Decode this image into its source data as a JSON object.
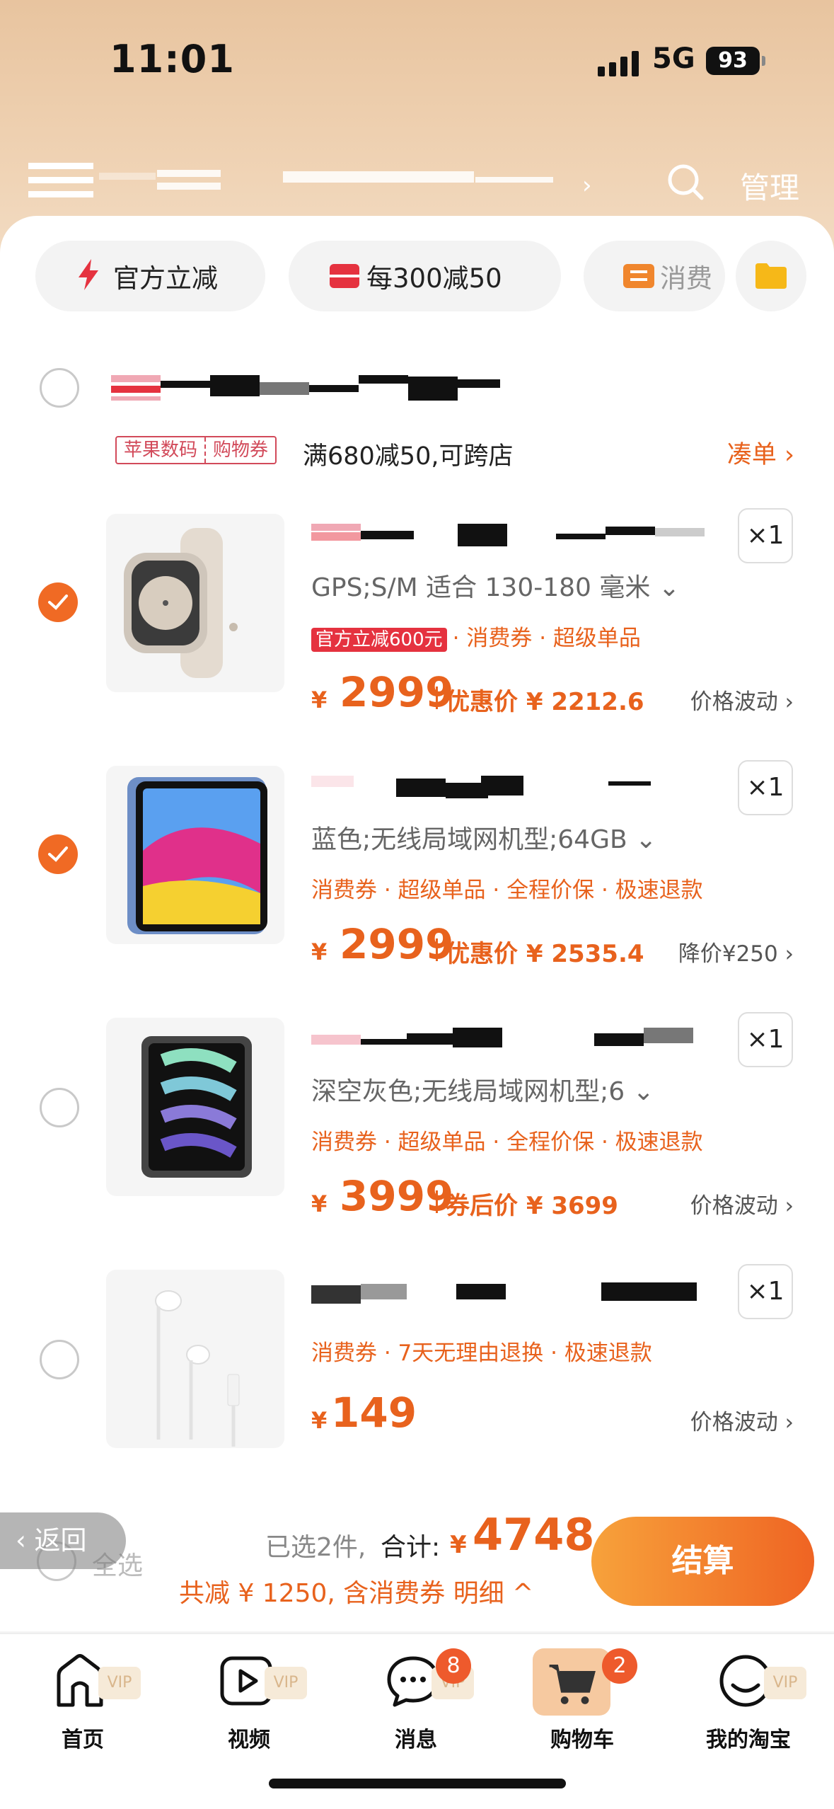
{
  "status_bar": {
    "time": "11:01",
    "network": "5G",
    "battery": "93"
  },
  "header": {
    "chevron": "›",
    "manage": "管理"
  },
  "chips": [
    {
      "label": "官方立减",
      "icon": "lightning-icon"
    },
    {
      "label": "每300减50",
      "icon": "coupon-icon"
    },
    {
      "label": "消费",
      "icon": "ticket-icon"
    }
  ],
  "store": {
    "coupon_tag_left": "苹果数码",
    "coupon_tag_right": "购物券",
    "coupon_text": "满680减50,可跨店",
    "coudan": "凑单 ›"
  },
  "items": [
    {
      "checked": true,
      "qty": "×1",
      "spec": "GPS;S/M 适合 130-180 毫米 ⌄",
      "red_tag": "官方立减600元",
      "tags": "· 消费券 · 超级单品",
      "yen": "¥",
      "price": "2999",
      "deal": "优惠价 ¥ 2212.6",
      "trend": "价格波动 ›"
    },
    {
      "checked": true,
      "qty": "×1",
      "spec": "蓝色;无线局域网机型;64GB ⌄",
      "red_tag": "",
      "tags": "消费券 · 超级单品 · 全程价保 · 极速退款",
      "yen": "¥",
      "price": "2999",
      "deal": "优惠价 ¥ 2535.4",
      "trend": "降价¥250 ›"
    },
    {
      "checked": false,
      "qty": "×1",
      "spec": "深空灰色;无线局域网机型;6  ⌄",
      "red_tag": "",
      "tags": "消费券 · 超级单品 · 全程价保 · 极速退款",
      "yen": "¥",
      "price": "3999",
      "deal": "券后价 ¥ 3699",
      "trend": "价格波动 ›"
    },
    {
      "checked": false,
      "qty": "×1",
      "spec": "",
      "red_tag": "",
      "tags": "消费券 · 7天无理由退换 · 极速退款",
      "yen": "¥",
      "price": "149",
      "deal": "",
      "trend": "价格波动 ›"
    }
  ],
  "checkout": {
    "back": "‹ 返回",
    "select_all": "全选",
    "selected_count": "已选2件,",
    "total_label": "合计:",
    "total_yen": "¥",
    "total": "4748",
    "saved": "共减 ¥ 1250, 含消费券  明细 ^",
    "pay_button": "结算"
  },
  "tabbar": [
    {
      "label": "首页",
      "icon": "home-icon",
      "vip": "VIP",
      "badge": ""
    },
    {
      "label": "视频",
      "icon": "video-play-icon",
      "vip": "VIP",
      "badge": ""
    },
    {
      "label": "消息",
      "icon": "message-icon",
      "vip": "VIP",
      "badge": "8"
    },
    {
      "label": "购物车",
      "icon": "cart-icon",
      "vip": "",
      "badge": "2"
    },
    {
      "label": "我的淘宝",
      "icon": "smile-icon",
      "vip": "VIP",
      "badge": ""
    }
  ],
  "colors": {
    "accent": "#e8621d",
    "red": "#e5323f",
    "header_bg": "#e8c49f"
  }
}
